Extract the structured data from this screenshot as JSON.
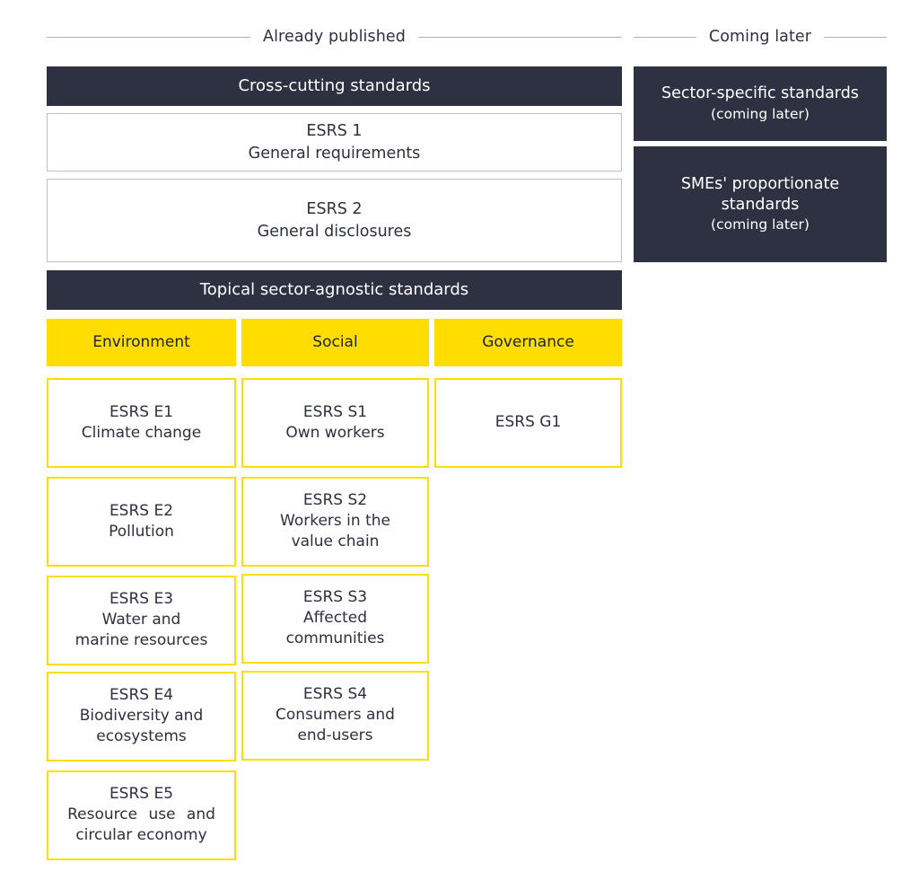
{
  "title": "ESRS standards architecture",
  "colors": {
    "dark": "#2E3142",
    "yellow": "#FFDD00",
    "rule": "#A9B1BD",
    "card_border_gray": "#B9C0CA",
    "text_dark": "#2C3041",
    "text_light": "#FFFFFF",
    "background": "#FFFFFF"
  },
  "sections": {
    "published": {
      "caption": "Already published"
    },
    "coming": {
      "caption": "Coming later"
    }
  },
  "published": {
    "cross_cutting": {
      "header": "Cross-cutting standards",
      "cards": [
        {
          "code": "ESRS 1",
          "name": "General requirements"
        },
        {
          "code": "ESRS 2",
          "name": "General disclosures"
        }
      ]
    },
    "topical": {
      "header": "Topical sector-agnostic standards",
      "columns": [
        {
          "category": "Environment",
          "standards": [
            {
              "code": "ESRS E1",
              "lines": [
                "Climate change"
              ]
            },
            {
              "code": "ESRS   E2",
              "lines": [
                "Pollution"
              ]
            },
            {
              "code": "ESRS E3",
              "lines": [
                "Water and",
                "marine resources"
              ]
            },
            {
              "code": "ESRS E4",
              "lines": [
                "Biodiversity and",
                "ecosystems"
              ]
            },
            {
              "code": "ESRS E5",
              "lines": [
                "Resource  use  and",
                "circular economy"
              ]
            }
          ]
        },
        {
          "category": "Social",
          "standards": [
            {
              "code": "ESRS S1",
              "lines": [
                "Own workers"
              ]
            },
            {
              "code": "ESRS S2",
              "lines": [
                "Workers in the",
                "value chain"
              ]
            },
            {
              "code": "ESRS S3",
              "lines": [
                "Affected",
                "communities"
              ]
            },
            {
              "code": "ESRS S4",
              "lines": [
                "Consumers and",
                "end-users"
              ]
            }
          ]
        },
        {
          "category": "Governance",
          "standards": [
            {
              "code": "ESRS G1",
              "lines": []
            }
          ]
        }
      ]
    }
  },
  "coming": {
    "cards": [
      {
        "title": "Sector-specific standards",
        "subtitle": "(coming later)"
      },
      {
        "title_line_1": "SMEs' proportionate",
        "title_line_2": "standards",
        "subtitle": "(coming later)"
      }
    ]
  }
}
